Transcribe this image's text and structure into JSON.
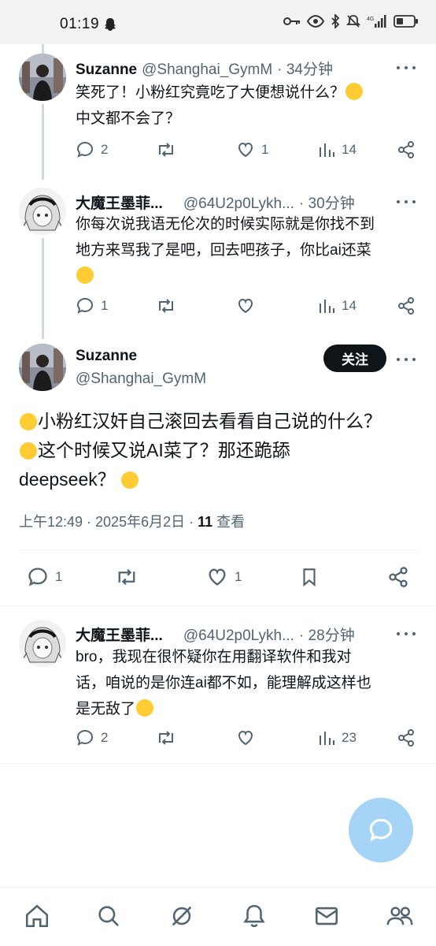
{
  "status_bar": {
    "time": "01:19",
    "network": "4G"
  },
  "colors": {
    "accent": "#1d9bf0",
    "fab": "#a6d4f7",
    "text": "#0f1419",
    "secondary": "#536471"
  },
  "replies_above": [
    {
      "author": "Suzanne",
      "handle": "@Shanghai_GymM",
      "time": "· 34分钟",
      "text_line1": "笑死了！小粉红究竟吃了大便想说什么？",
      "text_line2": "中文都不会了？",
      "stats": {
        "replies": "2",
        "reposts": "",
        "likes": "1",
        "views": "14"
      }
    },
    {
      "author": "大魔王墨菲...",
      "handle": "@64U2p0Lykh...",
      "time": "· 30分钟",
      "text_line1": "你每次说我语无伦次的时候实际就是你找不到",
      "text_line2": "地方来骂我了是吧，回去吧孩子，你比ai还菜",
      "stats": {
        "replies": "1",
        "reposts": "",
        "likes": "",
        "views": "14"
      }
    }
  ],
  "main_post": {
    "author": "Suzanne",
    "handle": "@Shanghai_GymM",
    "follow_label": "关注",
    "text_line1": "小粉红汉奸自己滚回去看看自己说的什么？",
    "text_line2": "这个时候又说AI菜了？那还跪舔",
    "text_line3": "deepseek？",
    "timestamp": "上午12:49 · 2025年6月2日 · ",
    "views_count": "11",
    "views_label": " 查看",
    "stats": {
      "replies": "1",
      "reposts": "",
      "likes": "1"
    }
  },
  "reply_below": {
    "author": "大魔王墨菲...",
    "handle": "@64U2p0Lykh...",
    "time": "· 28分钟",
    "text_line1": "bro，我现在很怀疑你在用翻译软件和我对",
    "text_line2": "话，咱说的是你连ai都不如，能理解成这样也",
    "text_line3": "是无敌了",
    "stats": {
      "replies": "2",
      "reposts": "",
      "likes": "",
      "views": "23"
    }
  },
  "icons": [
    "home-icon",
    "search-icon",
    "grok-icon",
    "notifications-icon",
    "messages-icon",
    "communities-icon",
    "reply-fab-icon"
  ]
}
